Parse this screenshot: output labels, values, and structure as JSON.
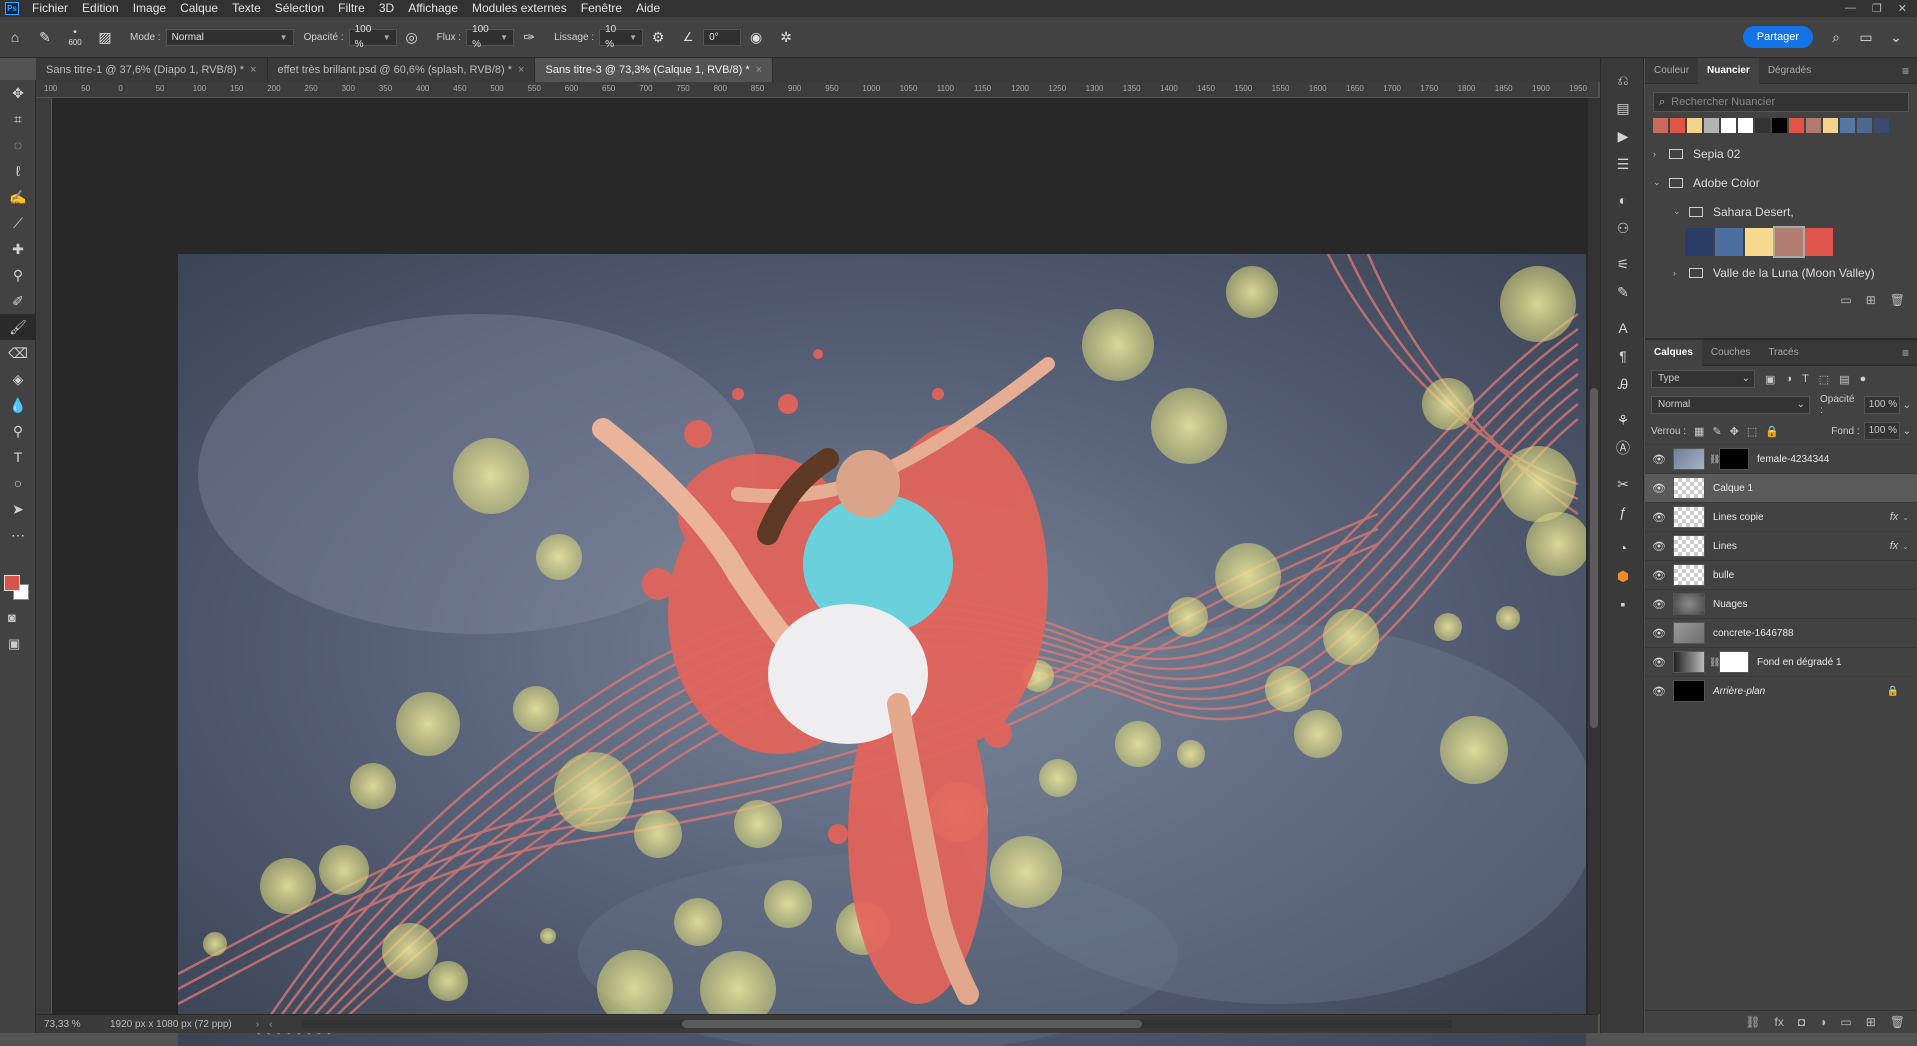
{
  "menubar": {
    "logo": "Ps",
    "items": [
      "Fichier",
      "Edition",
      "Image",
      "Calque",
      "Texte",
      "Sélection",
      "Filtre",
      "3D",
      "Affichage",
      "Modules externes",
      "Fenêtre",
      "Aide"
    ]
  },
  "options": {
    "brush_size": "600",
    "mode_label": "Mode :",
    "mode_value": "Normal",
    "opacity_label": "Opacité :",
    "opacity_value": "100 %",
    "flow_label": "Flux :",
    "flow_value": "100 %",
    "smoothing_label": "Lissage :",
    "smoothing_value": "10 %",
    "angle_value": "0°",
    "share_label": "Partager"
  },
  "tabs": [
    {
      "label": "Sans titre-1 @ 37,6% (Diapo 1, RVB/8) *"
    },
    {
      "label": "effet très brillant.psd @ 60,6% (splash, RVB/8) *"
    },
    {
      "label": "Sans titre-3 @ 73,3% (Calque 1, RVB/8) *"
    }
  ],
  "rulers": {
    "h_ticks": [
      "100",
      "50",
      "0",
      "50",
      "100",
      "150",
      "200",
      "250",
      "300",
      "350",
      "400",
      "450",
      "500",
      "550",
      "600",
      "650",
      "700",
      "750",
      "800",
      "850",
      "900",
      "950",
      "1000",
      "1050",
      "1100",
      "1150",
      "1200",
      "1250",
      "1300",
      "1350",
      "1400",
      "1450",
      "1500",
      "1550",
      "1600",
      "1650",
      "1700",
      "1750",
      "1800",
      "1850",
      "1900",
      "1950"
    ]
  },
  "status": {
    "zoom": "73,33 %",
    "doc_size": "1920 px x 1080 px (72 ppp)"
  },
  "swatches_panel": {
    "tabs": [
      "Couleur",
      "Nuancier",
      "Dégradés"
    ],
    "search_placeholder": "Rechercher Nuancier",
    "recent_colors": [
      "#c96a5e",
      "#e05546",
      "#f1d38c",
      "#b3b3b3",
      "#ffffff",
      "#ffffff",
      "#333333",
      "#000000",
      "#e05546",
      "#b07a6e",
      "#f1d38c",
      "#5577a0",
      "#4a6890",
      "#3a4a70"
    ],
    "groups": {
      "sepia": "Sepia 02",
      "adobe_color": "Adobe Color",
      "sahara": "Sahara Desert,",
      "valle": "Valle de la Luna (Moon Valley)"
    },
    "sahara_colors": [
      "#283c66",
      "#4d6ea0",
      "#f4d98e",
      "#b07d70",
      "#e0564c"
    ]
  },
  "layers_panel": {
    "tabs": [
      "Calques",
      "Couches",
      "Tracés"
    ],
    "filter_label": "Type",
    "blend_mode": "Normal",
    "opacity_label": "Opacité :",
    "opacity_value": "100 %",
    "lock_label": "Verrou :",
    "fill_label": "Fond :",
    "fill_value": "100 %",
    "layers": [
      {
        "name": "female-4234344"
      },
      {
        "name": "Calque 1"
      },
      {
        "name": "Lines copie",
        "fx": "fx"
      },
      {
        "name": "Lines",
        "fx": "fx"
      },
      {
        "name": "bulle"
      },
      {
        "name": "Nuages"
      },
      {
        "name": "concrete-1646788"
      },
      {
        "name": "Fond en dégradé 1"
      },
      {
        "name": "Arrière-plan"
      }
    ]
  }
}
